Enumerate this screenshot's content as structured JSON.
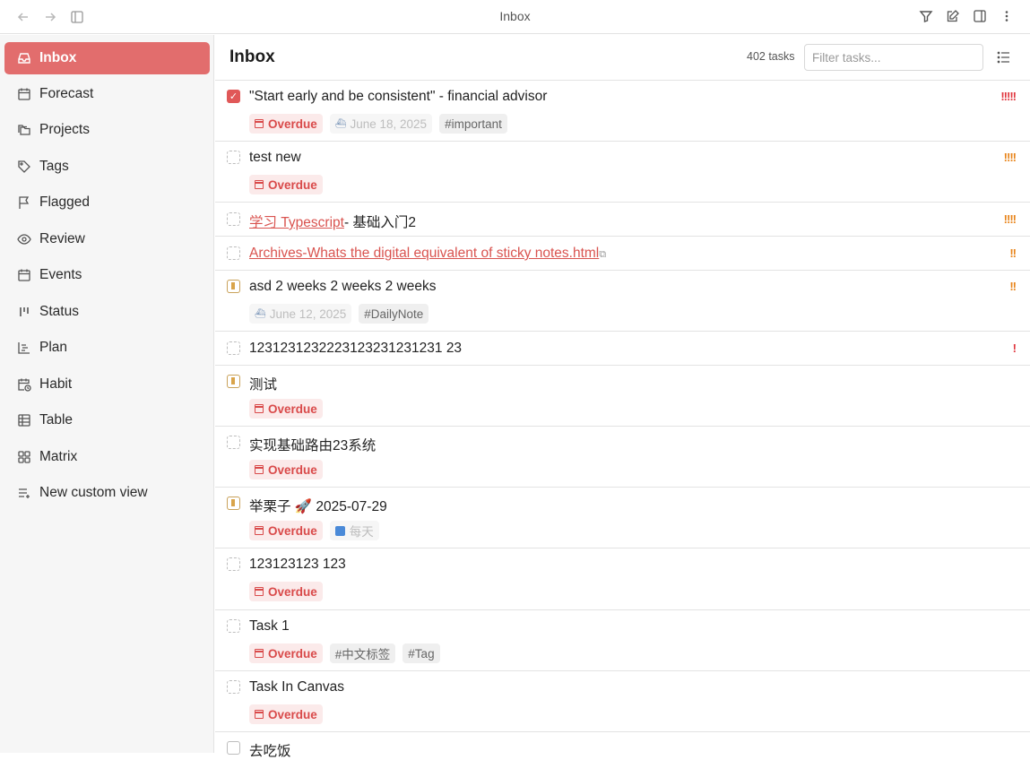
{
  "window": {
    "title": "Inbox"
  },
  "sidebar": {
    "items": [
      {
        "label": "Inbox",
        "icon": "inbox-icon",
        "active": true
      },
      {
        "label": "Forecast",
        "icon": "calendar-icon"
      },
      {
        "label": "Projects",
        "icon": "folders-icon"
      },
      {
        "label": "Tags",
        "icon": "tag-icon"
      },
      {
        "label": "Flagged",
        "icon": "flag-icon"
      },
      {
        "label": "Review",
        "icon": "eye-icon"
      },
      {
        "label": "Events",
        "icon": "calendar-icon"
      },
      {
        "label": "Status",
        "icon": "kanban-icon"
      },
      {
        "label": "Plan",
        "icon": "gantt-icon"
      },
      {
        "label": "Habit",
        "icon": "calendar-clock-icon"
      },
      {
        "label": "Table",
        "icon": "table-icon"
      },
      {
        "label": "Matrix",
        "icon": "grid-icon"
      },
      {
        "label": "New custom view",
        "icon": "list-plus-icon"
      }
    ]
  },
  "main": {
    "title": "Inbox",
    "task_count": "402 tasks",
    "filter_placeholder": "Filter tasks..."
  },
  "tasks": [
    {
      "title": "\"Start early and be consistent\" - financial advisor",
      "priority": "!!!!!",
      "overdue": "Overdue",
      "date": "June 18, 2025",
      "tag1": "#important"
    },
    {
      "title": "test new",
      "priority": "!!!!",
      "overdue": "Overdue"
    },
    {
      "link": "学习 Typescript",
      "rest": "- 基础入门2",
      "priority": "!!!!"
    },
    {
      "link": "Archives-Whats the digital equivalent of sticky notes.html",
      "priority": "!!"
    },
    {
      "title": "asd 2 weeks 2 weeks 2 weeks",
      "priority": "!!",
      "date": "June 12, 2025",
      "tag1": "#DailyNote"
    },
    {
      "title": "1231231232223123231231231 23",
      "priority": "!"
    },
    {
      "title": "测试",
      "overdue": "Overdue"
    },
    {
      "title": "实现基础路由23系统",
      "overdue": "Overdue"
    },
    {
      "title": "举栗子 🚀 2025-07-29",
      "overdue": "Overdue",
      "repeat": "每天"
    },
    {
      "title": "123123123 123",
      "overdue": "Overdue"
    },
    {
      "title": "Task 1",
      "overdue": "Overdue",
      "tag1": "#中文标签",
      "tag2": "#Tag"
    },
    {
      "title": "Task In Canvas",
      "overdue": "Overdue"
    },
    {
      "title": "去吃饭"
    }
  ]
}
